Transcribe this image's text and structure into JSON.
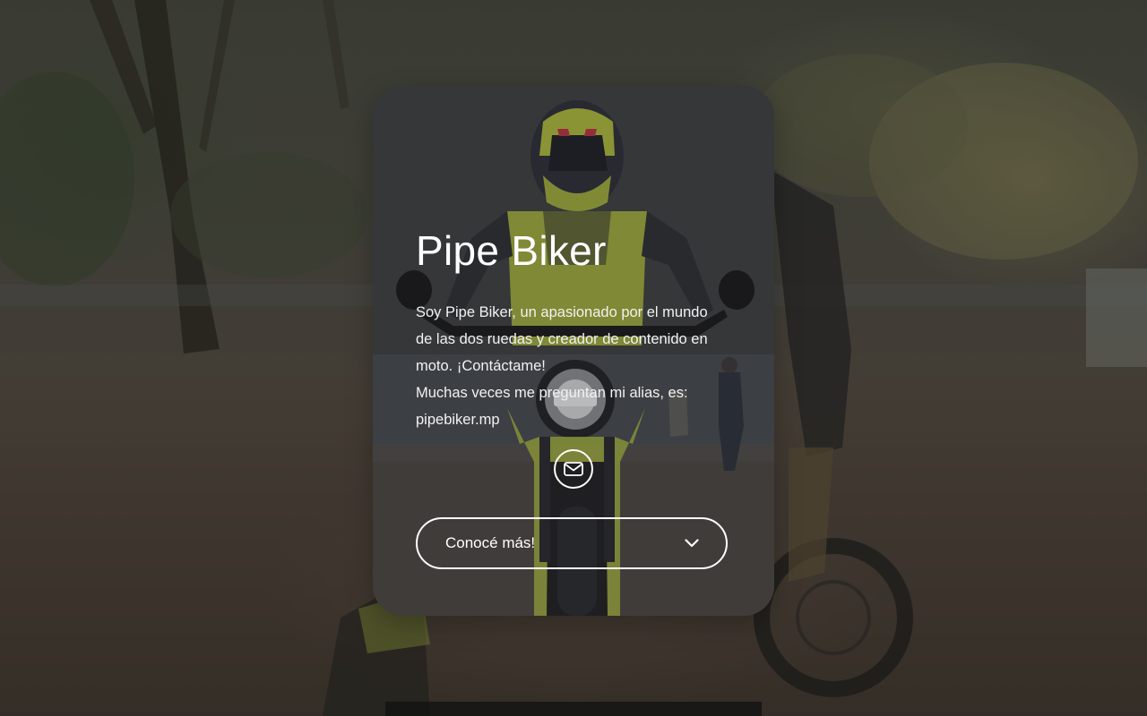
{
  "profile": {
    "name": "Pipe Biker",
    "description_lines": [
      "Soy Pipe Biker, un apasionado por el mundo",
      "de las dos ruedas y creador de contenido en",
      "moto. ¡Contáctame!",
      "Muchas veces me preguntan mi alias, es:",
      "pipebiker.mp"
    ]
  },
  "actions": {
    "mail_icon": "envelope-icon",
    "more_label": "Conocé más!",
    "more_icon": "chevron-down-icon"
  },
  "colors": {
    "text": "#ffffff",
    "button_border": "#ffffff",
    "card_overlay": "#3a3a3a",
    "vest_accent": "#c8d84a"
  }
}
